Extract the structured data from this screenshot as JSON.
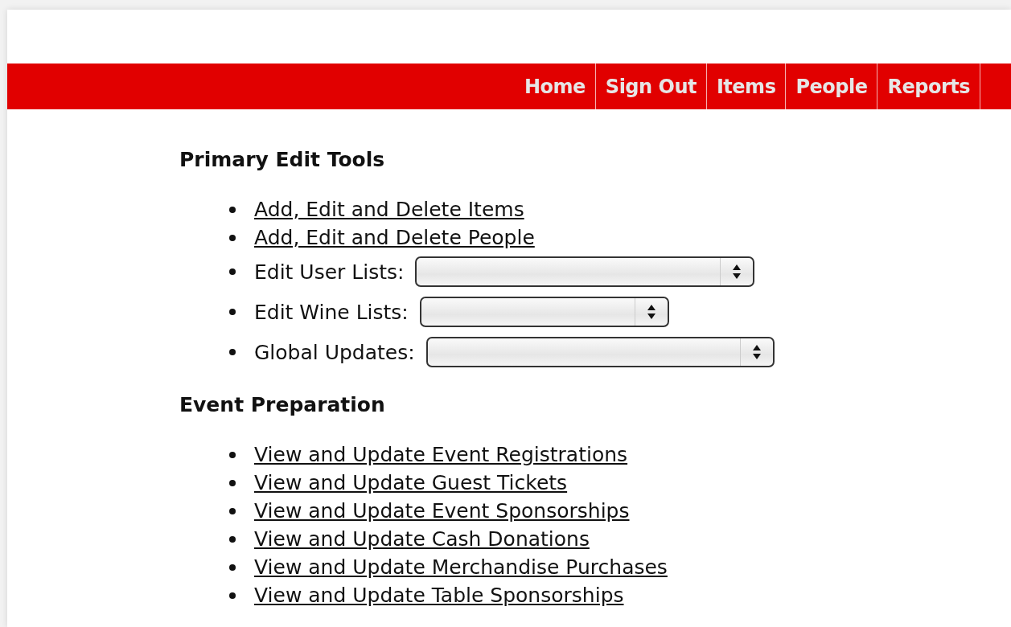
{
  "nav": [
    "Home",
    "Sign Out",
    "Items",
    "People",
    "Reports"
  ],
  "sections": [
    {
      "title": "Primary Edit Tools",
      "items": [
        {
          "kind": "link",
          "label": "Add, Edit and Delete Items"
        },
        {
          "kind": "link",
          "label": "Add, Edit and Delete People"
        },
        {
          "kind": "select",
          "label": "Edit User Lists:"
        },
        {
          "kind": "select",
          "label": "Edit Wine Lists:"
        },
        {
          "kind": "select",
          "label": "Global Updates:"
        }
      ]
    },
    {
      "title": "Event Preparation",
      "items": [
        {
          "kind": "link",
          "label": "View and Update Event Registrations"
        },
        {
          "kind": "link",
          "label": "View and Update Guest Tickets"
        },
        {
          "kind": "link",
          "label": "View and Update Event Sponsorships"
        },
        {
          "kind": "link",
          "label": "View and Update Cash Donations"
        },
        {
          "kind": "link",
          "label": "View and Update Merchandise Purchases"
        },
        {
          "kind": "link",
          "label": "View and Update Table Sponsorships"
        }
      ]
    }
  ]
}
